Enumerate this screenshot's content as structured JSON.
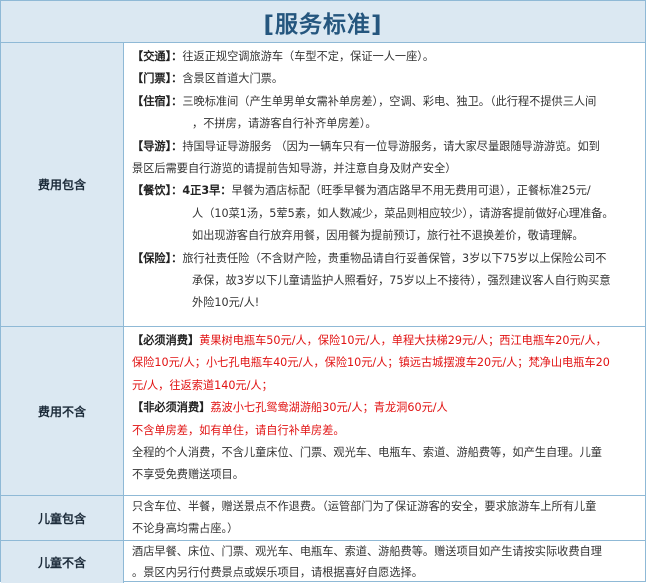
{
  "page_title": "[服务标准]",
  "sections": {
    "included": {
      "label": "费用包含",
      "traffic": {
        "heading": "【交通】：",
        "text": "往返正规空调旅游车（车型不定，保证一人一座）。"
      },
      "tickets": {
        "heading": "【门票】：",
        "text": "含景区首道大门票。"
      },
      "hotel": {
        "heading": "【住宿】：",
        "text_1": "三晚标准间（产生单男单女需补单房差），空调、彩电、独卫。（此行程不提供三人间",
        "text_2": "，不拼房，请游客自行补齐单房差）。"
      },
      "guide": {
        "heading": "【导游】：",
        "text_1": "持国导证导游服务 （因为一辆车只有一位导游服务，请大家尽量跟随导游游览。如到",
        "text_2": "景区后需要自行游览的请提前告知导游，并注意自身及财产安全）"
      },
      "meals": {
        "heading": "【餐饮】：",
        "lead": "4正3早：",
        "text_1": "早餐为酒店标配（旺季早餐为酒店路早不用无费用可退），正餐标准25元/",
        "text_2": "人（10菜1汤，5荤5素，如人数减少，菜品则相应较少），请游客提前做好心理准备。",
        "text_3": "如出现游客自行放弃用餐，因用餐为提前预订，旅行社不退换差价，敬请理解。"
      },
      "insurance": {
        "heading": "【保险】：",
        "text_1": "旅行社责任险（不含财产险，贵重物品请自行妥善保管，3岁以下75岁以上保险公司不",
        "text_2": "承保，故3岁以下儿童请监护人照看好，75岁以上不接待），强烈建议客人自行购买意",
        "text_3": "外险10元/人!"
      }
    },
    "excluded": {
      "label": "费用不含",
      "required_heading": "【必须消费】",
      "required_lines": [
        "黄果树电瓶车50元/人，保险10元/人，单程大扶梯29元/人；西江电瓶车20元/人，",
        "保险10元/人；小七孔电瓶车40元/人，保险10元/人；镇远古城摆渡车20元/人；梵净山电瓶车20",
        "元/人，往返索道140元/人；"
      ],
      "optional_heading": "【非必须消费】",
      "optional_text": "荔波小七孔鸳鸯湖游船30元/人；青龙洞60元/人",
      "single_room_note": "不含单房差，如有单住，请自行补单房差。",
      "general_lines": [
        "全程的个人消费，不含儿童床位、门票、观光车、电瓶车、索道、游船费等，如产生自理。儿童",
        "不享受免费赠送项目。"
      ]
    },
    "child_included": {
      "label": "儿童包含",
      "lines": [
        "只含车位、半餐，赠送景点不作退费。（运管部门为了保证游客的安全，要求旅游车上所有儿童",
        "不论身高均需占座。）"
      ]
    },
    "child_excluded": {
      "label": "儿童不含",
      "lines": [
        "酒店早餐、床位、门票、观光车、电瓶车、索道、游船费等。赠送项目如产生请按实际收费自理",
        "。景区内另行付费景点或娱乐项目，请根据喜好自愿选择。"
      ]
    }
  }
}
